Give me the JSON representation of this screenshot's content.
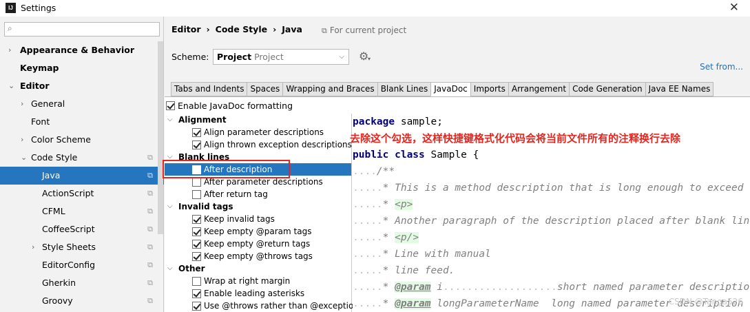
{
  "window": {
    "title": "Settings",
    "app_icon": "IJ",
    "close": "✕"
  },
  "search": {
    "value": "",
    "placeholder": ""
  },
  "sidebar": {
    "items": [
      {
        "label": "Appearance & Behavior",
        "arrow": "›"
      },
      {
        "label": "Keymap"
      },
      {
        "label": "Editor",
        "arrow": "⌄"
      },
      {
        "label": "General",
        "arrow": "›"
      },
      {
        "label": "Font"
      },
      {
        "label": "Color Scheme",
        "arrow": "›"
      },
      {
        "label": "Code Style",
        "arrow": "⌄"
      },
      {
        "label": "Java"
      },
      {
        "label": "ActionScript"
      },
      {
        "label": "CFML"
      },
      {
        "label": "CoffeeScript"
      },
      {
        "label": "Style Sheets",
        "arrow": "›"
      },
      {
        "label": "EditorConfig"
      },
      {
        "label": "Gherkin"
      },
      {
        "label": "Groovy"
      }
    ]
  },
  "header": {
    "breadcrumb": [
      "Editor",
      "Code Style",
      "Java"
    ],
    "separator": "›",
    "for_project": "For current project",
    "scheme_label": "Scheme:",
    "scheme_value": "Project",
    "scheme_sub": "Project",
    "set_from": "Set from..."
  },
  "tabs": [
    "Tabs and Indents",
    "Spaces",
    "Wrapping and Braces",
    "Blank Lines",
    "JavaDoc",
    "Imports",
    "Arrangement",
    "Code Generation",
    "Java EE Names"
  ],
  "active_tab": "JavaDoc",
  "enable_javadoc": {
    "label": "Enable JavaDoc formatting",
    "checked": true
  },
  "options": {
    "groups": [
      {
        "label": "Alignment",
        "items": [
          {
            "label": "Align parameter descriptions",
            "checked": true
          },
          {
            "label": "Align thrown exception descriptions",
            "checked": true
          }
        ]
      },
      {
        "label": "Blank lines",
        "items": [
          {
            "label": "After description",
            "checked": false
          },
          {
            "label": "After parameter descriptions",
            "checked": false
          },
          {
            "label": "After return tag",
            "checked": false
          }
        ]
      },
      {
        "label": "Invalid tags",
        "items": [
          {
            "label": "Keep invalid tags",
            "checked": true
          },
          {
            "label": "Keep empty @param tags",
            "checked": true
          },
          {
            "label": "Keep empty @return tags",
            "checked": true
          },
          {
            "label": "Keep empty @throws tags",
            "checked": true
          }
        ]
      },
      {
        "label": "Other",
        "items": [
          {
            "label": "Wrap at right margin",
            "checked": false
          },
          {
            "label": "Enable leading asterisks",
            "checked": true
          },
          {
            "label": "Use @throws rather than @exception",
            "checked": true
          }
        ]
      }
    ]
  },
  "code": {
    "l1_kw": "package",
    "l1_rest": " sample;",
    "l2_kw": "public class",
    "l2_rest": " Sample {",
    "l3_dots": "....",
    "l3_cm": "/**",
    "l4_dots": ".....",
    "l4_cm": "* This is a method description that is long enough to exceed",
    "l5_dots": ".....",
    "l5_cm": "* ",
    "l5_tag": "<p>",
    "l6_dots": ".....",
    "l6_cm": "* Another paragraph of the description placed after blank line",
    "l7_dots": ".....",
    "l7_cm": "* ",
    "l7_tag": "<p/>",
    "l8_dots": ".....",
    "l8_cm": "* Line with manual",
    "l9_dots": ".....",
    "l9_cm": "* line feed.",
    "l10_dots": ".....",
    "l10_cm": "* ",
    "l10_tag": "@param",
    "l10_rest": " i",
    "l10_pad": "...................",
    "l10_desc": "short named parameter description",
    "l11_dots": ".....",
    "l11_cm": "* ",
    "l11_tag": "@param",
    "l11_rest": " longParameterName  long named parameter description"
  },
  "annotation": "去除这个勾选，这样快捷键格式化代码会将当前文件所有的注释换行去除",
  "watermark": "CSDN @Tanga526",
  "colors": {
    "selection": "#2675bf",
    "annotation": "#e3261f",
    "keyword": "#000080",
    "comment": "#808080",
    "link": "#2470b3"
  }
}
